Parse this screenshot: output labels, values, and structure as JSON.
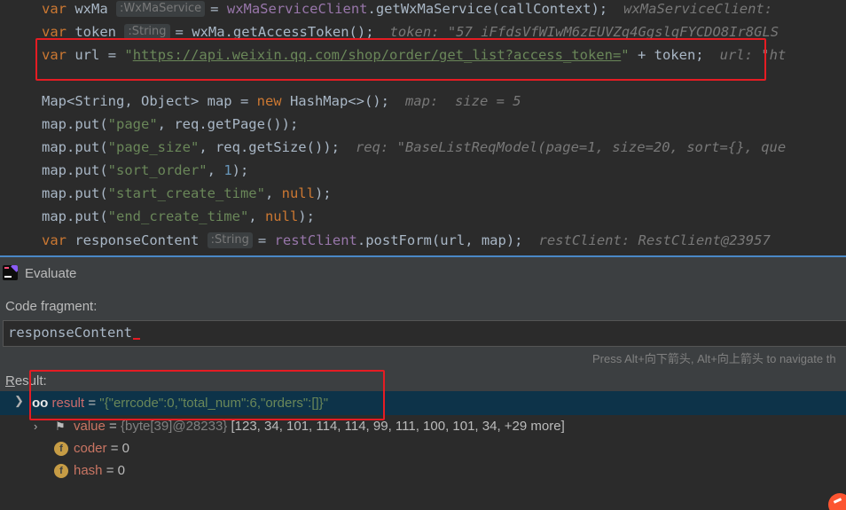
{
  "editor": {
    "line1": {
      "kw": "var",
      "name": "wxMa",
      "hint": ":WxMaService",
      "eq": "=",
      "obj": "wxMaServiceClient",
      "call": ".getWxMaService(callContext);",
      "debug": "wxMaServiceClient:"
    },
    "line2": {
      "kw": "var",
      "name": "token",
      "hint": ":String",
      "eq": "=",
      "rest": "wxMa.getAccessToken();",
      "debug": "token: \"57_iFfdsVfWIwM6zEUVZq4GgslqFYCDO8Ir8GLS"
    },
    "line3": {
      "kw": "var",
      "name": "url",
      "eq": "=",
      "url": "https://api.weixin.qq.com/shop/order/get_list?access_token=",
      "rest": " + token;",
      "debug": "url: \"ht"
    },
    "line4": {
      "pre": "Map<String, Object> map = ",
      "kw": "new",
      "rest": " HashMap<>();",
      "debug": "map:  size = 5"
    },
    "line5": {
      "pre": "map.put(",
      "str": "\"page\"",
      "rest": ", req.getPage());"
    },
    "line6": {
      "pre": "map.put(",
      "str": "\"page_size\"",
      "rest": ", req.getSize());",
      "debug": "req: \"BaseListReqModel(page=1, size=20, sort={}, que"
    },
    "line7": {
      "pre": "map.put(",
      "str": "\"sort_order\"",
      "mid": ", ",
      "num": "1",
      "rest": ");"
    },
    "line8": {
      "pre": "map.put(",
      "str": "\"start_create_time\"",
      "mid": ", ",
      "kw": "null",
      "rest": ");"
    },
    "line9": {
      "pre": "map.put(",
      "str": "\"end_create_time\"",
      "mid": ", ",
      "kw": "null",
      "rest": ");"
    },
    "line10": {
      "kw": "var",
      "name": "responseContent",
      "hint": ":String",
      "eq": "=",
      "obj": "restClient",
      "call": ".postForm(url, map);",
      "debug": "restClient: RestClient@23957"
    }
  },
  "evaluate": {
    "title": "Evaluate",
    "code_fragment_label": "Code fragment:",
    "code_fragment_value": "responseContent",
    "hint": "Press Alt+向下箭头, Alt+向上箭头 to navigate th",
    "result_label_u": "R",
    "result_label_rest": "esult:",
    "result": {
      "icon": "oo",
      "name": "result",
      "eq": " = ",
      "value": "\"{\"errcode\":0,\"total_num\":6,\"orders\":[]}\""
    },
    "children": [
      {
        "name": "value",
        "type": "{byte[39]@28233}",
        "value": "[123, 34, 101, 114, 114, 99, 111, 100, 101, 34, +29 more]"
      },
      {
        "name": "coder",
        "value": "0"
      },
      {
        "name": "hash",
        "value": "0"
      }
    ]
  },
  "colors": {
    "highlight_box": "#e51c23",
    "keyword": "#cc7832",
    "string": "#6a8759",
    "method": "#ffc66d",
    "selection": "#0d3349"
  },
  "icons": [
    "intellij-icon",
    "chevron-down-icon",
    "chevron-right-icon",
    "glasses-icon",
    "flag-icon",
    "field-f-icon",
    "csdn-logo-icon"
  ]
}
